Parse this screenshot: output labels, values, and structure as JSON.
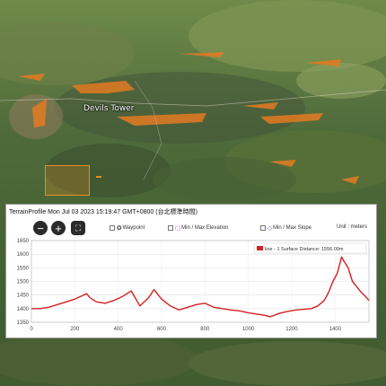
{
  "map": {
    "place_label": "Devils Tower",
    "colors": {
      "accent_orange": "#f08a1e"
    }
  },
  "panel": {
    "title": "TerrainProfile Mon Jul 03 2023 15:19:47 GMT+0800 (台北標準時間)",
    "zoom_out_icon": "minus-circle-icon",
    "zoom_in_icon": "plus-circle-icon",
    "fit_icon": "fullscreen-icon",
    "options": {
      "waypoint": "Waypoint",
      "min_max_elevation": "Min / Max Elevation",
      "min_max_slope": "Min / Max Slope"
    },
    "unit_label": "Unit : meters"
  },
  "chart_data": {
    "type": "line",
    "series": [
      {
        "name": "line - 1 Surface Distance: 1556.00m",
        "color": "#d42020",
        "x": [
          0,
          40,
          80,
          120,
          160,
          200,
          240,
          255,
          270,
          300,
          340,
          380,
          420,
          460,
          500,
          540,
          565,
          580,
          600,
          640,
          680,
          720,
          760,
          800,
          840,
          880,
          920,
          960,
          1000,
          1040,
          1080,
          1100,
          1140,
          1180,
          1220,
          1260,
          1290,
          1320,
          1350,
          1370,
          1390,
          1410,
          1420,
          1430,
          1440,
          1460,
          1480,
          1500,
          1520,
          1540,
          1556
        ],
        "y": [
          1400,
          1400,
          1405,
          1415,
          1425,
          1435,
          1450,
          1455,
          1440,
          1425,
          1420,
          1430,
          1445,
          1465,
          1410,
          1440,
          1470,
          1455,
          1435,
          1410,
          1395,
          1405,
          1415,
          1420,
          1405,
          1400,
          1395,
          1392,
          1385,
          1380,
          1375,
          1370,
          1382,
          1390,
          1395,
          1398,
          1400,
          1410,
          1430,
          1460,
          1500,
          1530,
          1560,
          1590,
          1575,
          1550,
          1500,
          1480,
          1460,
          1445,
          1430
        ]
      }
    ],
    "xlim": [
      0,
      1556
    ],
    "ylim": [
      1350,
      1650
    ],
    "xticks": [
      0,
      200,
      400,
      600,
      800,
      1000,
      1200,
      1400
    ],
    "yticks": [
      1350,
      1400,
      1450,
      1500,
      1550,
      1600,
      1650
    ],
    "grid": true,
    "legend_position": "top-right"
  }
}
